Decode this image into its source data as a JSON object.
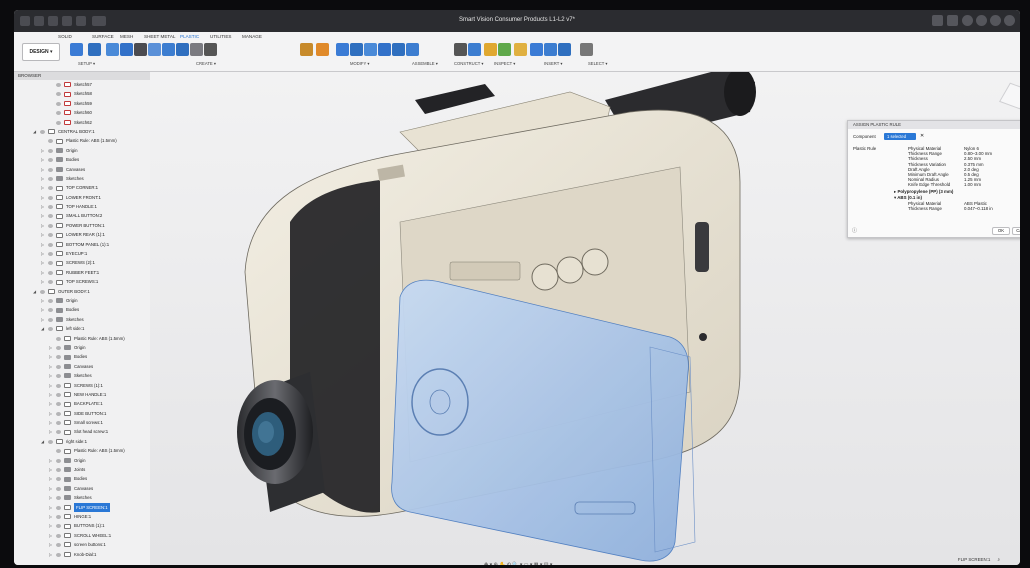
{
  "window": {
    "title": "Smart Vision Consumer Products L1-L2 v7*"
  },
  "ribbon": {
    "workspace": "DESIGN ▾",
    "tabs": [
      "SOLID",
      "SURFACE",
      "MESH",
      "SHEET METAL",
      "PLASTIC",
      "UTILITIES",
      "MANAGE"
    ],
    "active_tab": "PLASTIC",
    "groups": [
      "SETUP ▾",
      "CREATE ▾",
      "MODIFY ▾",
      "ASSEMBLE ▾",
      "CONSTRUCT ▾",
      "INSPECT ▾",
      "INSERT ▾",
      "SELECT ▾"
    ]
  },
  "browser": {
    "title": "BROWSER",
    "rows": [
      {
        "label": "Sketch57",
        "level": 2,
        "kind": "sketch",
        "arrow": ""
      },
      {
        "label": "Sketch58",
        "level": 2,
        "kind": "sketch",
        "arrow": ""
      },
      {
        "label": "Sketch59",
        "level": 2,
        "kind": "sketch",
        "arrow": ""
      },
      {
        "label": "Sketch60",
        "level": 2,
        "kind": "sketch",
        "arrow": ""
      },
      {
        "label": "Sketch62",
        "level": 2,
        "kind": "sketch",
        "arrow": ""
      },
      {
        "label": "CENTRAL BODY:1",
        "level": 0,
        "kind": "component",
        "arrow": "◢"
      },
      {
        "label": "Plastic Rule: ABS (1.5mm)",
        "level": 1,
        "kind": "rule",
        "arrow": ""
      },
      {
        "label": "Origin",
        "level": 1,
        "kind": "folder",
        "arrow": "▷"
      },
      {
        "label": "Bodies",
        "level": 1,
        "kind": "folder",
        "arrow": "▷"
      },
      {
        "label": "Canvases",
        "level": 1,
        "kind": "folder",
        "arrow": "▷"
      },
      {
        "label": "Sketches",
        "level": 1,
        "kind": "folder",
        "arrow": "▷"
      },
      {
        "label": "TOP CORNER:1",
        "level": 1,
        "kind": "component",
        "arrow": "▷"
      },
      {
        "label": "LOWER FRONT:1",
        "level": 1,
        "kind": "component",
        "arrow": "▷"
      },
      {
        "label": "TOP HANDLE:1",
        "level": 1,
        "kind": "component",
        "arrow": "▷"
      },
      {
        "label": "SMALL BUTTON:2",
        "level": 1,
        "kind": "component",
        "arrow": "▷"
      },
      {
        "label": "POWER BUTTON:1",
        "level": 1,
        "kind": "component",
        "arrow": "▷"
      },
      {
        "label": "LOWER REAR (1):1",
        "level": 1,
        "kind": "component",
        "arrow": "▷"
      },
      {
        "label": "BOTTOM PANEL (1):1",
        "level": 1,
        "kind": "component",
        "arrow": "▷"
      },
      {
        "label": "EYECUP:1",
        "level": 1,
        "kind": "component",
        "arrow": "▷"
      },
      {
        "label": "SCREWS (2):1",
        "level": 1,
        "kind": "component",
        "arrow": "▷"
      },
      {
        "label": "RUBBER FEET:1",
        "level": 1,
        "kind": "component",
        "arrow": "▷"
      },
      {
        "label": "TOP SCREWS:1",
        "level": 1,
        "kind": "component",
        "arrow": "▷"
      },
      {
        "label": "OUTER BODY:1",
        "level": 0,
        "kind": "component",
        "arrow": "◢"
      },
      {
        "label": "Origin",
        "level": 1,
        "kind": "folder",
        "arrow": "▷"
      },
      {
        "label": "Bodies",
        "level": 1,
        "kind": "folder",
        "arrow": "▷"
      },
      {
        "label": "Sketches",
        "level": 1,
        "kind": "folder",
        "arrow": "▷"
      },
      {
        "label": "left side:1",
        "level": 1,
        "kind": "component",
        "arrow": "◢"
      },
      {
        "label": "Plastic Rule: ABS (1.5mm)",
        "level": 2,
        "kind": "rule",
        "arrow": ""
      },
      {
        "label": "Origin",
        "level": 2,
        "kind": "folder",
        "arrow": "▷"
      },
      {
        "label": "Bodies",
        "level": 2,
        "kind": "folder",
        "arrow": "▷"
      },
      {
        "label": "Canvases",
        "level": 2,
        "kind": "folder",
        "arrow": "▷"
      },
      {
        "label": "Sketches",
        "level": 2,
        "kind": "folder",
        "arrow": "▷"
      },
      {
        "label": "SCREWS (1):1",
        "level": 2,
        "kind": "component",
        "arrow": "▷"
      },
      {
        "label": "NEW HANDLE:1",
        "level": 2,
        "kind": "component",
        "arrow": "▷"
      },
      {
        "label": "BACKPLATE:1",
        "level": 2,
        "kind": "component",
        "arrow": "▷"
      },
      {
        "label": "SIDE BUTTON:1",
        "level": 2,
        "kind": "component",
        "arrow": "▷"
      },
      {
        "label": "Small screws:1",
        "level": 2,
        "kind": "component",
        "arrow": "▷"
      },
      {
        "label": "Slot head screw:1",
        "level": 2,
        "kind": "component",
        "arrow": "▷"
      },
      {
        "label": "right side:1",
        "level": 1,
        "kind": "component",
        "arrow": "◢"
      },
      {
        "label": "Plastic Rule: ABS (1.5mm)",
        "level": 2,
        "kind": "rule",
        "arrow": ""
      },
      {
        "label": "Origin",
        "level": 2,
        "kind": "folder",
        "arrow": "▷"
      },
      {
        "label": "Joints",
        "level": 2,
        "kind": "folder",
        "arrow": "▷"
      },
      {
        "label": "Bodies",
        "level": 2,
        "kind": "folder",
        "arrow": "▷"
      },
      {
        "label": "Canvases",
        "level": 2,
        "kind": "folder",
        "arrow": "▷"
      },
      {
        "label": "Sketches",
        "level": 2,
        "kind": "folder",
        "arrow": "▷"
      },
      {
        "label": "FLIP SCREEN:1",
        "level": 2,
        "kind": "component",
        "arrow": "▷",
        "selected": true
      },
      {
        "label": "HINGE:1",
        "level": 2,
        "kind": "component",
        "arrow": "▷"
      },
      {
        "label": "BUTTONS (1):1",
        "level": 2,
        "kind": "component",
        "arrow": "▷"
      },
      {
        "label": "SCROLL WHEEL:1",
        "level": 2,
        "kind": "component",
        "arrow": "▷"
      },
      {
        "label": "screen buttons:1",
        "level": 2,
        "kind": "component",
        "arrow": "▷"
      },
      {
        "label": "Knob-Dial:1",
        "level": 2,
        "kind": "component",
        "arrow": "▷"
      }
    ]
  },
  "dialog": {
    "title": "ASSIGN PLASTIC RULE",
    "component_label": "Component",
    "component_value": "1 selected",
    "rule_label": "Plastic Rule",
    "nylon_props": [
      [
        "Physical Material",
        "Nylon 6"
      ],
      [
        "Thickness Range",
        "0.80–3.00 mm"
      ],
      [
        "Thickness",
        "2.50 mm"
      ],
      [
        "Thickness Variation",
        "0.375 mm"
      ],
      [
        "Draft Angle",
        "2.0 deg"
      ],
      [
        "Minimum Draft Angle",
        "0.5 deg"
      ],
      [
        "Nominal Radius",
        "1.25 mm"
      ],
      [
        "Knife Edge Threshold",
        "1.00 mm"
      ]
    ],
    "pp_rule": "Polypropylene (PP) (3 mm)",
    "abs_rule": "ABS (0.1 in)",
    "abs_props": [
      [
        "Physical Material",
        "ABS Plastic"
      ],
      [
        "Thickness Range",
        "0.047–0.118 in"
      ]
    ],
    "ok": "OK",
    "cancel": "Cancel"
  },
  "status": {
    "selection": "FLIP SCREEN:1"
  },
  "colors": {
    "accent": "#2a78d6",
    "body": "#ece6d8",
    "screen": "#a9c6ea"
  }
}
